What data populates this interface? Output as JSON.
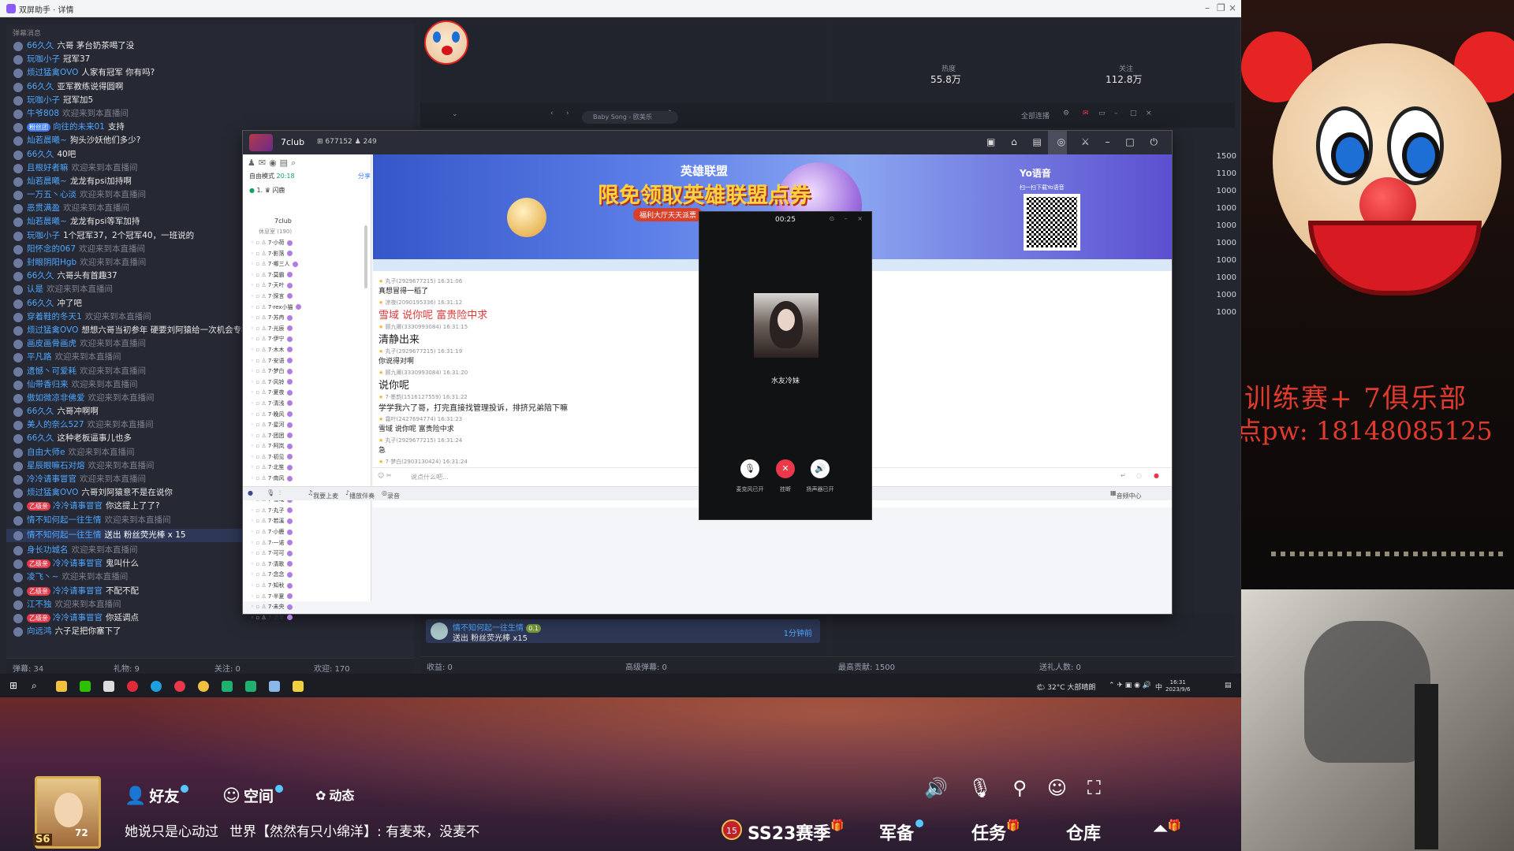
{
  "window": {
    "title": "双屏助手 · 详情"
  },
  "left_panel": {
    "header": "弹幕消息",
    "chat": [
      {
        "name": "66久久",
        "text": "六哥 茅台奶茶喝了没",
        "sys": false
      },
      {
        "name": "玩咖小子",
        "text": "冠军37",
        "sys": false
      },
      {
        "name": "烦过猛禽OVO",
        "text": "人家有冠军 你有吗?",
        "sys": false
      },
      {
        "name": "66久久",
        "text": "亚军教练说得圆啊",
        "sys": false
      },
      {
        "name": "玩咖小子",
        "text": "冠军加5",
        "sys": false
      },
      {
        "name": "牛爷808",
        "text": "欢迎来到本直播间",
        "sys": true
      },
      {
        "name": "向往的未来01",
        "text": "支持",
        "sys": false,
        "badge": "粉丝团"
      },
      {
        "name": "灿若晨曦~",
        "text": "狗头沙妖他们多少?",
        "sys": false
      },
      {
        "name": "66久久",
        "text": "40吧",
        "sys": false
      },
      {
        "name": "且根好者嘛",
        "text": "欢迎来到本直播间",
        "sys": true
      },
      {
        "name": "灿若晨曦~",
        "text": "龙龙有psi加持啊",
        "sys": false
      },
      {
        "name": "一万五丶心淡",
        "text": "欢迎来到本直播间",
        "sys": true
      },
      {
        "name": "恶贯满盈",
        "text": "欢迎来到本直播间",
        "sys": true
      },
      {
        "name": "灿若晨曦~",
        "text": "龙龙有psi等军加持",
        "sys": false
      },
      {
        "name": "玩咖小子",
        "text": "1个冠军37，2个冠军40，一班说的",
        "sys": false
      },
      {
        "name": "阳怀念的067",
        "text": "欢迎来到本直播间",
        "sys": true
      },
      {
        "name": "封眼阴阳Hgb",
        "text": "欢迎来到本直播间",
        "sys": true
      },
      {
        "name": "66久久",
        "text": "六哥头有首趣37",
        "sys": false
      },
      {
        "name": "认是",
        "text": "欢迎来到本直播间",
        "sys": true
      },
      {
        "name": "66久久",
        "text": "冲了吧",
        "sys": false
      },
      {
        "name": "穿着鞋的冬天1",
        "text": "欢迎来到本直播间",
        "sys": true
      },
      {
        "name": "烦过猛禽OVO",
        "text": "想想六哥当初参年 硬要刘阿猿给一次机会专核",
        "sys": false
      },
      {
        "name": "画皮画骨画虎",
        "text": "欢迎来到本直播间",
        "sys": true
      },
      {
        "name": "平凡路",
        "text": "欢迎来到本直播间",
        "sys": true
      },
      {
        "name": "遗憾丶可爱耗",
        "text": "欢迎来到本直播间",
        "sys": true
      },
      {
        "name": "仙带香归来",
        "text": "欢迎来到本直播间",
        "sys": true
      },
      {
        "name": "傲如微凉非佛爱",
        "text": "欢迎来到本直播间",
        "sys": true
      },
      {
        "name": "66久久",
        "text": "六哥冲啊啊",
        "sys": false
      },
      {
        "name": "美人的奈么527",
        "text": "欢迎来到本直播间",
        "sys": true
      },
      {
        "name": "66久久",
        "text": "这种老板逼事儿也多",
        "sys": false
      },
      {
        "name": "自由大师e",
        "text": "欢迎来到本直播间",
        "sys": true
      },
      {
        "name": "星辰眼嘛石对熔",
        "text": "欢迎来到本直播间",
        "sys": true
      },
      {
        "name": "冷冷请事冒官",
        "text": "欢迎来到本直播间",
        "sys": true
      },
      {
        "name": "烦过猛禽OVO",
        "text": "六哥刘阿猿意不是在说你",
        "sys": false
      },
      {
        "name": "冷冷请事冒官",
        "text": "你这提上了了?",
        "sys": false,
        "badge": "乙级亲"
      },
      {
        "name": "情不知何起一往生情",
        "text": "欢迎来到本直播间",
        "sys": true
      },
      {
        "name": "情不知何起一往生情",
        "text": "送出 粉丝荧光棒 x 15",
        "gift": true
      },
      {
        "name": "身长功城名",
        "text": "欢迎来到本直播间",
        "sys": true
      },
      {
        "name": "冷冷请事冒官",
        "text": "鬼叫什么",
        "sys": false,
        "badge": "乙级亲"
      },
      {
        "name": "凌飞丶~",
        "text": "欢迎来到本直播间",
        "sys": true
      },
      {
        "name": "冷冷请事冒官",
        "text": "不配不配",
        "sys": false,
        "badge": "乙级亲"
      },
      {
        "name": "江不独",
        "text": "欢迎来到本直播间",
        "sys": true
      },
      {
        "name": "冷冷请事冒官",
        "text": "你延调点",
        "sys": false,
        "badge": "乙级亲"
      },
      {
        "name": "向远鸿",
        "text": "六子足把你塞下了",
        "sys": false
      }
    ],
    "footer": {
      "danmu": "弹幕: 34",
      "gift": "礼物: 9",
      "follow": "关注: 0",
      "welcome": "欢迎: 170"
    }
  },
  "stats": {
    "hot_label": "热度",
    "hot_value": "55.8万",
    "fans_label": "关注",
    "fans_value": "112.8万"
  },
  "rank_values": [
    "1500",
    "1100",
    "1000",
    "1000",
    "1000",
    "1000",
    "1000",
    "1000",
    "1000",
    "1000"
  ],
  "music": {
    "search_placeholder": "Baby Song - 欧美乐",
    "sync_label": "全部连播"
  },
  "gift_card": {
    "name": "情不知何起一往生情",
    "level": "0.1",
    "text": "送出 粉丝荧光棒 x15",
    "time": "1分钟前"
  },
  "bottom_stats": {
    "income": "收益: 0",
    "hi_gift": "高级弹幕: 0",
    "contrib": "最高贡献: 1500",
    "gift_users": "送礼人数: 0"
  },
  "club": {
    "name": "7club",
    "meta": "⊞ 677152   ♟ 249",
    "mode": "自由模式",
    "mode_time": "20:18",
    "mode_right": "分享",
    "channel1": "1.  ♛ 闪鹿",
    "tree_head": "7club",
    "tree_sub": "休息室 (190)",
    "members": [
      "7·小荷",
      "7·影落",
      "7·哪三人",
      "7·莫霸",
      "7·天叶",
      "7·探言",
      "7·rex小猫",
      "7·苏冉",
      "7·光辰",
      "7·伊宁",
      "7·木木",
      "7·安语",
      "7·梦白",
      "7·风铃",
      "7·夏夜",
      "7·清浅",
      "7·晚风",
      "7·星河",
      "7·团团",
      "7·阿岚",
      "7·初见",
      "7·北笙",
      "7·南风",
      "7·微雨",
      "7·雪域",
      "7·丸子",
      "7·若溪",
      "7·小鹿",
      "7·一诺",
      "7·可可",
      "7·清歌",
      "7·念念",
      "7·知秋",
      "7·半夏",
      "7·未央",
      "7·流年"
    ],
    "banner": {
      "sub": "英雄联盟",
      "title": "限免领取英雄联盟点券",
      "tag": "福利大厅天天派票",
      "logo": "Yo语音",
      "qr_label": "扫一扫下载Yo语音"
    },
    "messages": [
      {
        "hdr": "丸子(2929677215)  16:31:06",
        "body": "真想冒得一稻了",
        "style": "small"
      },
      {
        "hdr": "凉夜(2090195336)  16:31:12",
        "body": "雪域 说你呢 富贵险中求",
        "style": "red"
      },
      {
        "hdr": "顾九卿(3330993084)  16:31:15",
        "body": "清静出来",
        "style": "big"
      },
      {
        "hdr": "丸子(2929677215)  16:31:19",
        "body": "你说得对啊",
        "style": "small"
      },
      {
        "hdr": "顾九卿(3330993084)  16:31:20",
        "body": "说你呢",
        "style": "big"
      },
      {
        "hdr": "7·墨韵(1516127559)  16:31:22",
        "body": "学学我六了哥，打完直接找管理投诉，排挤兄弟陪下嘛",
        "style": "mid"
      },
      {
        "hdr": "霜叶(2427694774)  16:31:23",
        "body": "雪域 说你呢 富贵险中求",
        "style": "small"
      },
      {
        "hdr": "丸子(2929677215)  16:31:24",
        "body": "急",
        "style": "small"
      },
      {
        "hdr": "7·梦白(2903130424)  16:31:24",
        "body": "雪域 说你呢 富贵险中求",
        "style": "huge"
      }
    ],
    "input_placeholder": "说点什么吧...",
    "bottom": {
      "mic": "我要上麦",
      "music": "播放伴奏",
      "record": "录音",
      "right": "音频中心"
    }
  },
  "call": {
    "timer": "00:25",
    "name": "水友冷妹",
    "mic_label": "麦克风已开",
    "hang_label": "挂断",
    "speaker_label": "扬声器已开"
  },
  "taskbar": {
    "weather": "32°C 大部晴朗",
    "ime": "中",
    "time": "16:31",
    "date": "2023/9/6"
  },
  "overlay": {
    "line1": "训练赛+  7俱乐部",
    "line2": "点pw: 18148085125"
  },
  "game": {
    "level": "72",
    "rank": "S6",
    "friends": "好友",
    "space": "空间",
    "moments": "动态",
    "chat_left": "她说只是心动过",
    "chat_channel": "世界",
    "chat_msg": "【然然有只小绵洋】: 有麦来，没麦不",
    "season_num": "15",
    "season": "SS23赛季",
    "army": "军备",
    "tasks": "任务",
    "storage": "仓库"
  },
  "colors": {
    "accent_blue": "#4ea7ff",
    "hangup_red": "#e8384a",
    "overlay_red": "#e23b2e",
    "gold": "#ffd23e"
  }
}
